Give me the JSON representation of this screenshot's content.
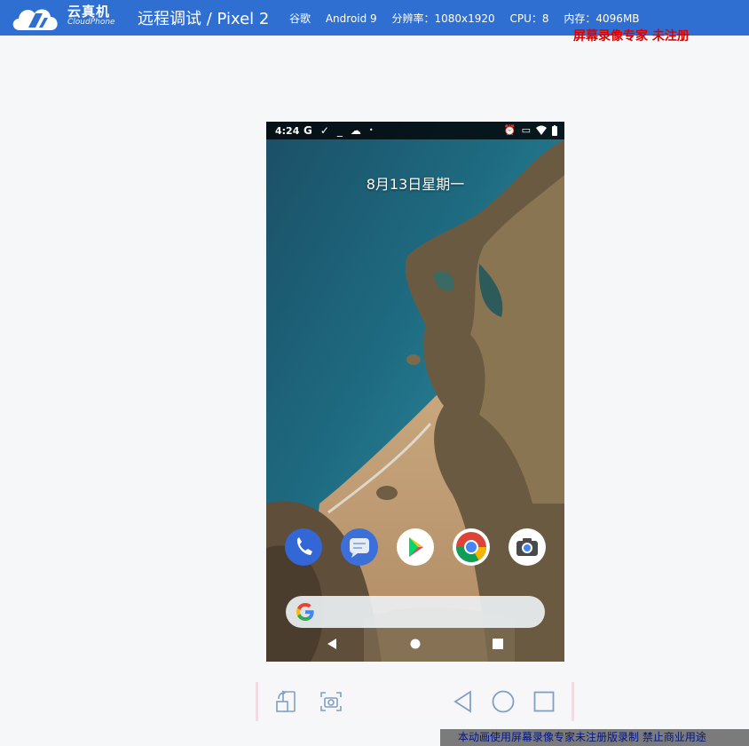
{
  "header": {
    "brand_cn": "云真机",
    "brand_en": "CloudPhone",
    "title": "远程调试 / Pixel 2",
    "specs": {
      "maker": "谷歌",
      "os": "Android 9",
      "resolution": "分辨率：1080x1920",
      "cpu": "CPU：8",
      "memory": "内存：4096MB"
    }
  },
  "watermark_top": "屏幕录像专家  未注册",
  "phone": {
    "status_time": "4:24",
    "status_left_icons": [
      "google-icon",
      "checkmark-icon",
      "dash-icon",
      "cloud-icon",
      "dot-icon"
    ],
    "status_right_icons": [
      "alarm-icon",
      "cast-icon",
      "wifi-icon",
      "battery-icon"
    ],
    "date": "8月13日星期一",
    "dock_apps": [
      {
        "name": "phone-app-icon",
        "color": "#3367d6"
      },
      {
        "name": "messages-app-icon",
        "color": "#3d6fd8"
      },
      {
        "name": "play-store-app-icon",
        "color": "#ffffff"
      },
      {
        "name": "chrome-app-icon",
        "color": "#ffffff"
      },
      {
        "name": "camera-app-icon",
        "color": "#ffffff"
      }
    ],
    "search_icon": "google-g-icon",
    "nav": [
      "back-icon",
      "home-icon",
      "recents-icon"
    ]
  },
  "controls": [
    "rotate-icon",
    "screenshot-icon",
    "back-icon",
    "home-icon",
    "recents-icon"
  ],
  "watermark_bottom": "本动画使用屏幕录像专家未注册版录制  禁止商业用途",
  "colors": {
    "header_bg": "#2f6fd1",
    "watermark_red": "#e00000",
    "watermark_blue": "#00168a"
  }
}
